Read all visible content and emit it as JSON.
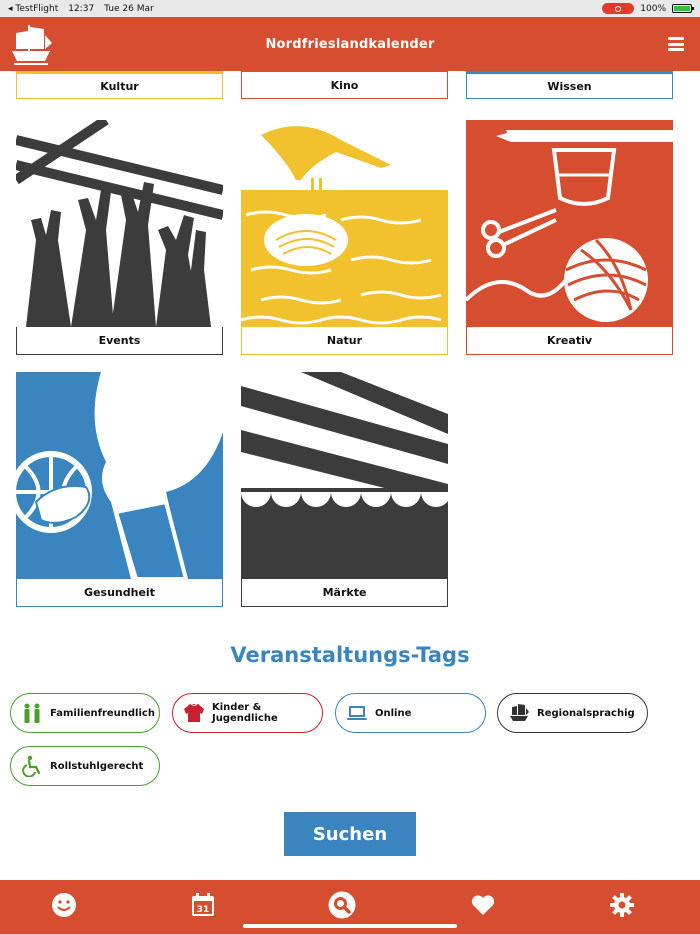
{
  "status_bar": {
    "app": "◂ TestFlight",
    "time": "12:37",
    "date": "Tue 26 Mar",
    "battery": "100%"
  },
  "header": {
    "title": "Nordfrieslandkalender"
  },
  "categories": [
    {
      "label": "Kultur",
      "color": "#f2c12e"
    },
    {
      "label": "Kino",
      "color": "#d64d2f"
    },
    {
      "label": "Wissen",
      "color": "#3a85c0"
    },
    {
      "label": "Events",
      "color": "#3c3c3c"
    },
    {
      "label": "Natur",
      "color": "#f2c12e"
    },
    {
      "label": "Kreativ",
      "color": "#d64d2f"
    },
    {
      "label": "Gesundheit",
      "color": "#3a85c0"
    },
    {
      "label": "Märkte",
      "color": "#3c3c3c"
    }
  ],
  "tags_section": {
    "title": "Veranstaltungs-Tags",
    "tags": [
      {
        "label": "Familienfreundlich",
        "color": "#4aa02c",
        "icon": "family-icon"
      },
      {
        "label": "Kinder & Jugendliche",
        "color": "#c8202e",
        "icon": "sweater-icon"
      },
      {
        "label": "Online",
        "color": "#3a85c0",
        "icon": "laptop-icon"
      },
      {
        "label": "Regionalsprachig",
        "color": "#333333",
        "icon": "ship-icon"
      },
      {
        "label": "Rollstuhlgerecht",
        "color": "#4aa02c",
        "icon": "wheelchair-icon"
      }
    ]
  },
  "search_button": {
    "label": "Suchen"
  },
  "tabbar": {
    "calendar_day": "31",
    "items": [
      "smiley-icon",
      "calendar-icon",
      "search-icon",
      "heart-icon",
      "gear-icon"
    ]
  },
  "colors": {
    "brand_red": "#d64d2f",
    "accent_blue": "#3a85c0",
    "yellow": "#f2c12e",
    "dark": "#3c3c3c"
  }
}
